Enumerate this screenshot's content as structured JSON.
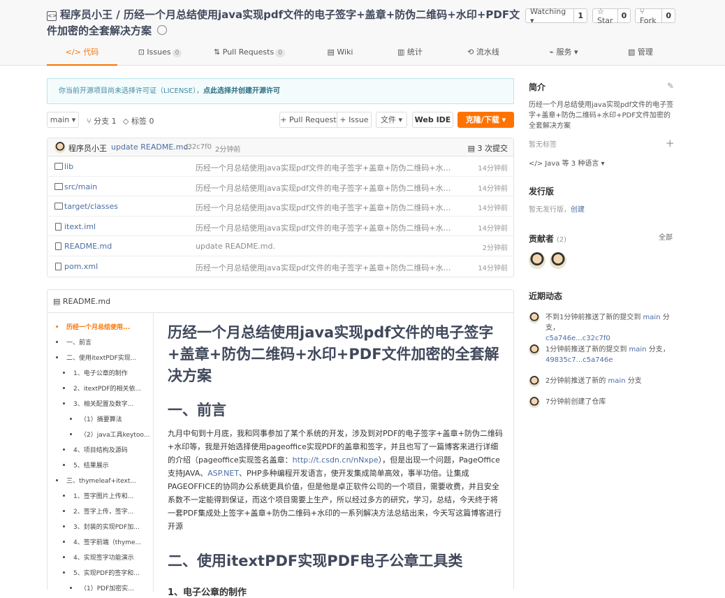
{
  "repo": {
    "owner": "程序员小王",
    "sep": " / ",
    "name": "历经一个月总结使用java实现pdf文件的电子签字+盖章+防伪二维码+水印+PDF文件加密的全套解决方案"
  },
  "actions": {
    "watch": {
      "label": "Watching ▾",
      "count": "1"
    },
    "star": {
      "label": "☆ Star",
      "count": "0"
    },
    "fork": {
      "label": "⑂ Fork",
      "count": "0"
    }
  },
  "tabs": [
    {
      "label": "</> 代码"
    },
    {
      "label": "⊡ Issues",
      "badge": "0"
    },
    {
      "label": "⇅ Pull Requests",
      "badge": "0"
    },
    {
      "label": "▤ Wiki"
    },
    {
      "label": "▥ 统计"
    },
    {
      "label": "⟲ 流水线"
    },
    {
      "label": "⌁ 服务 ▾"
    },
    {
      "label": "▧ 管理"
    }
  ],
  "license": {
    "text": "你当前开源项目尚未选择许可证（LICENSE），",
    "link": "点此选择并创建开源许可"
  },
  "toolbar": {
    "branch": "main ▾",
    "branches": "⑂ 分支 1",
    "tags": "◇ 标签 0",
    "pull_request": "+ Pull Request",
    "issue": "+ Issue",
    "file": "文件 ▾",
    "webide": "Web IDE",
    "clone": "克隆/下载 ▾"
  },
  "commit": {
    "author": "程序员小王",
    "message": "update README.md.",
    "sha": "c32c7f0",
    "time": "2分钟前",
    "count": "▤ 3 次提交"
  },
  "files": [
    {
      "name": "lib",
      "type": "folder",
      "message": "历经一个月总结使用java实现pdf文件的电子签字+盖章+防伪二维码+水印+P...",
      "time": "14分钟前"
    },
    {
      "name": "src/main",
      "type": "folder",
      "message": "历经一个月总结使用java实现pdf文件的电子签字+盖章+防伪二维码+水印+P...",
      "time": "14分钟前"
    },
    {
      "name": "target/classes",
      "type": "folder",
      "message": "历经一个月总结使用java实现pdf文件的电子签字+盖章+防伪二维码+水印+P...",
      "time": "14分钟前"
    },
    {
      "name": "itext.iml",
      "type": "file",
      "message": "历经一个月总结使用java实现pdf文件的电子签字+盖章+防伪二维码+水印+P...",
      "time": "14分钟前"
    },
    {
      "name": "README.md",
      "type": "file",
      "message": "update README.md.",
      "time": "2分钟前"
    },
    {
      "name": "pom.xml",
      "type": "file",
      "message": "历经一个月总结使用java实现pdf文件的电子签字+盖章+防伪二维码+水印+P...",
      "time": "14分钟前"
    }
  ],
  "readme": {
    "header": "▤ README.md",
    "toc": [
      "历经一个月总结使用...",
      "一、前言",
      "二、使用itextPDF实现...",
      "1、电子公章的制作",
      "2、itextPDF的相关依...",
      "3、相关配置及数字...",
      "（1）摘要算法",
      "（2）java工具keytoo...",
      "4、项目结构及源码",
      "5、结果展示",
      "三、thymeleaf+itext...",
      "1、签字图片上传和...",
      "2、签字上传，签字...",
      "3、封装的实现PDF加...",
      "4、签字前端（thyme...",
      "4、实现签字功能演示",
      "5、实现PDF的签字和...",
      "（1）PDF加密实..."
    ],
    "title": "历经一个月总结使用java实现pdf文件的电子签字+盖章+防伪二维码+水印+PDF文件加密的全套解决方案",
    "h_intro": "一、前言",
    "para_before": "九月中旬到十月底，我和同事参加了某个系统的开发，涉及到对PDF的电子签字+盖章+防伪二维码+水印等，我是开始选择使用pageoffice实现PDF的盖章和签字，并且也写了一篇博客来进行详细的介绍（pageoffice实现签名盖章：",
    "para_link": "http://t.csdn.cn/nNxpe",
    "para_mid": "），但是出现一个问题，PageOffice支持JAVA、",
    "para_link2": "ASP.NET",
    "para_after": "、PHP多种编程开发语言，使开发集成简单高效，事半功倍。让集成PAGEOFFICE的协同办公系统更具价值，但是他是卓正软件公司的一个项目，需要收费，并且安全系数不一定能得到保证，而这个项目需要上生产，所以经过多方的研究，学习，总结，今天终于将一套PDF集成处上签字+盖章+防伪二维码+水印的一系列解决方法总结出来，今天写这篇博客进行开源",
    "h_itext": "二、使用itextPDF实现PDF电子公章工具类",
    "h_seal": "1、电子公章的制作"
  },
  "sidebar": {
    "intro_title": "简介",
    "intro_text": "历经一个月总结使用java实现pdf文件的电子签字+盖章+防伪二维码+水印+PDF文件加密的全套解决方案",
    "no_tags": "暂无标签",
    "lang": "</>  Java 等 3 种语言 ▾",
    "release_title": "发行版",
    "release_text": "暂无发行版，",
    "release_link": "创建",
    "contrib_title": "贡献者",
    "contrib_count": "(2)",
    "contrib_all": "全部",
    "activity_title": "近期动态",
    "activity": [
      {
        "text": "不到1分钟前推送了新的提交到 ",
        "branch": "main",
        "tail": " 分支，",
        "link": "c5a746e...c32c7f0"
      },
      {
        "text": "1分钟前推送了新的提交到 ",
        "branch": "main",
        "tail": " 分支，",
        "link": "49835c7...c5a746e"
      },
      {
        "text": "2分钟前推送了新的 ",
        "branch": "main",
        "tail": " 分支",
        "link": ""
      },
      {
        "text": "7分钟前创建了仓库",
        "branch": "",
        "tail": "",
        "link": ""
      }
    ]
  }
}
